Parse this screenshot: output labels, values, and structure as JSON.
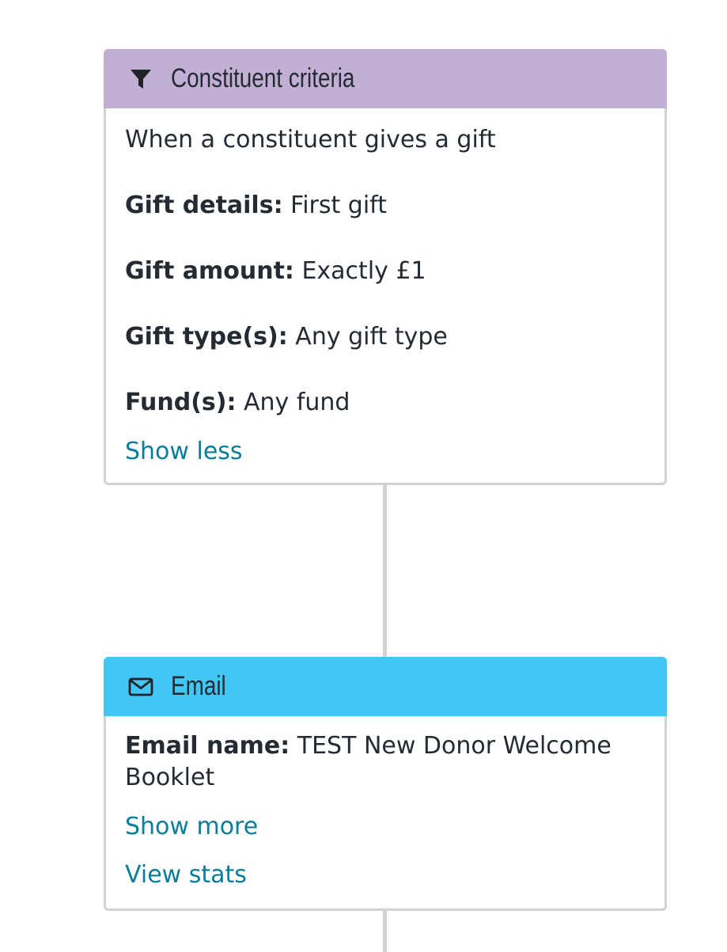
{
  "criteria_card": {
    "title": "Constituent criteria",
    "icon": "filter-icon",
    "header_color": "#c1afd4",
    "trigger_text": "When a constituent gives a gift",
    "fields": [
      {
        "label": "Gift details:",
        "value": "First gift"
      },
      {
        "label": "Gift amount:",
        "value": "Exactly £1"
      },
      {
        "label": "Gift type(s):",
        "value": "Any gift type"
      },
      {
        "label": "Fund(s):",
        "value": "Any fund"
      }
    ],
    "toggle_link": "Show less"
  },
  "email_card": {
    "title": "Email",
    "icon": "envelope-icon",
    "header_color": "#42c6f4",
    "email_name_label": "Email name:",
    "email_name_value": "TEST New Donor Welcome Booklet",
    "toggle_link": "Show more",
    "stats_link": "View stats"
  },
  "colors": {
    "link": "#0a7d99",
    "border": "#d2d2d2",
    "text": "#252b33"
  }
}
